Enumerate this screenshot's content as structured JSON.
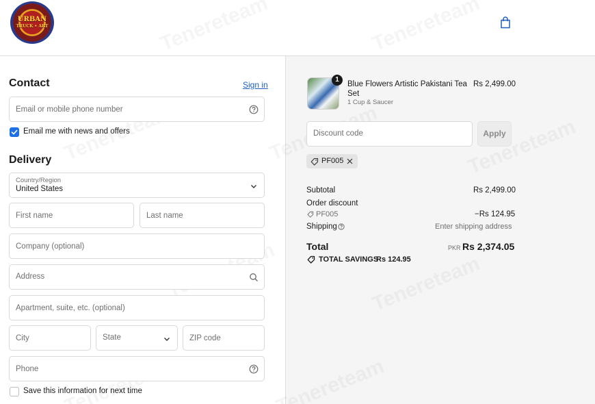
{
  "header": {
    "logo_line1": "URBAN",
    "logo_line2": "TRUCK • ART",
    "cart_icon": "shopping-bag-icon"
  },
  "contact": {
    "title": "Contact",
    "sign_in": "Sign in",
    "email_placeholder": "Email or mobile phone number",
    "newsletter_label": "Email me with news and offers",
    "newsletter_checked": true
  },
  "delivery": {
    "title": "Delivery",
    "country_label": "Country/Region",
    "country_value": "United States",
    "first_name_placeholder": "First name",
    "last_name_placeholder": "Last name",
    "company_placeholder": "Company (optional)",
    "address_placeholder": "Address",
    "apartment_placeholder": "Apartment, suite, etc. (optional)",
    "city_placeholder": "City",
    "state_label": "State",
    "zip_placeholder": "ZIP code",
    "phone_placeholder": "Phone",
    "save_info_label": "Save this information for next time",
    "save_info_checked": false
  },
  "order": {
    "item": {
      "name_line1": "Blue Flowers Artistic Pakistani Tea",
      "name_line2": "Set",
      "variant": "1 Cup & Saucer",
      "price": "Rs 2,499.00",
      "quantity": "1"
    },
    "discount_placeholder": "Discount code",
    "apply_label": "Apply",
    "applied_code": "PF005",
    "subtotal_label": "Subtotal",
    "subtotal_value": "Rs 2,499.00",
    "order_discount_label": "Order discount",
    "discount_code": "PF005",
    "discount_value": "−Rs 124.95",
    "shipping_label": "Shipping",
    "shipping_value": "Enter shipping address",
    "total_label": "Total",
    "currency": "PKR",
    "total_value": "Rs 2,374.05",
    "savings_label": "TOTAL SAVINGS",
    "savings_value": "Rs 124.95"
  },
  "watermark": "Tenereteam",
  "colors": {
    "accent": "#1f6fe5",
    "link": "#1f5fbf",
    "panel_bg": "#f5f5f5",
    "border": "#d9d9d9"
  }
}
